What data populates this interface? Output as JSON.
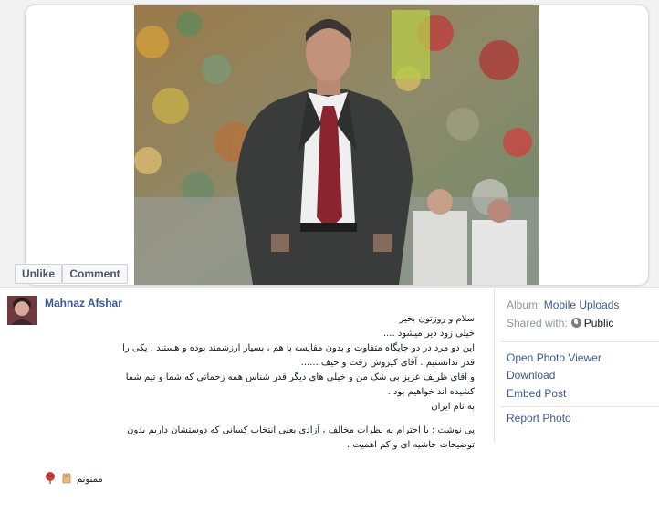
{
  "photo_actions": {
    "unlike_label": "Unlike",
    "comment_label": "Comment"
  },
  "post": {
    "author": "Mahnaz Afshar",
    "caption_lines": [
      "سلام و روزتون بخیر",
      "خیلی زود دیر میشود ....",
      "این دو مرد در دو جایگاه متفاوت و بدون مقایسه با هم ، بسیار ارزشمند بوده و هستند . یکی را",
      "قدر ندانستیم . آقای کیروش رفت و حیف ......",
      "و آقای ظریف عزیز بی شک من و خیلی های دیگر قدر شناس همه زحماتی که شما و تیم شما",
      "کشیده اند خواهیم بود .",
      "به نام ایران",
      "",
      "پی نوشت : با احترام به نظرات مخالف ، آزادی یعنی انتخاب کسانی که دوستشان داریم بدون",
      "توضیحات حاشیه ای و کم اهمیت ."
    ],
    "thanks": "ممنونم"
  },
  "sidebar": {
    "album_label": "Album:",
    "album_value": "Mobile Uploads",
    "shared_label": "Shared with:",
    "shared_value": "Public",
    "links": [
      "Open Photo Viewer",
      "Download",
      "Embed Post",
      "Report Photo"
    ]
  },
  "colors": {
    "link": "#3b5998",
    "muted": "#90949c"
  }
}
